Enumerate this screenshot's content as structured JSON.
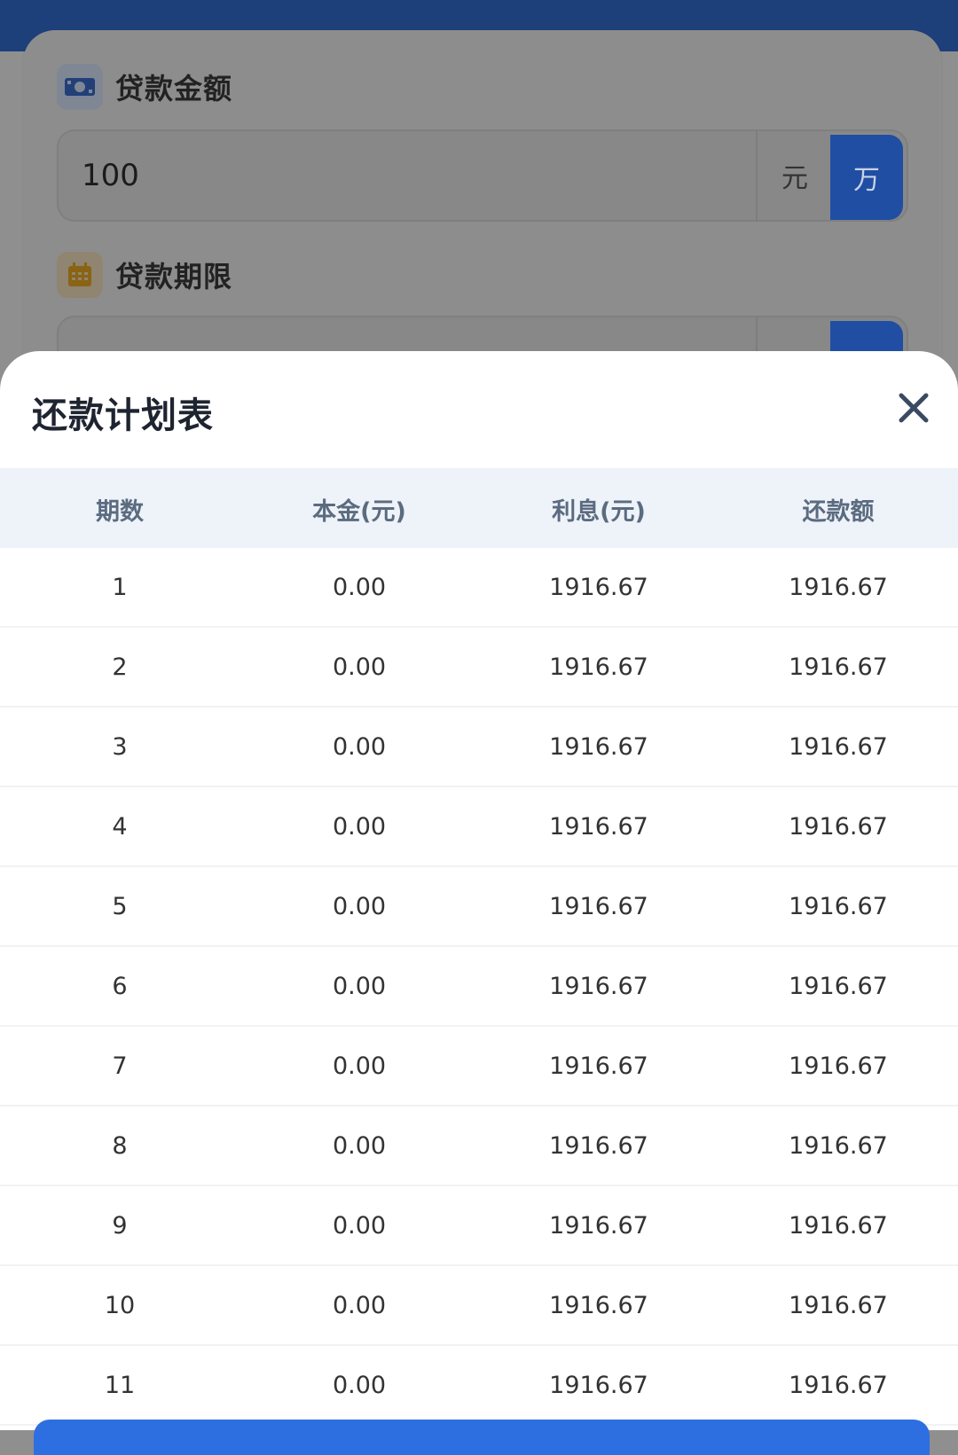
{
  "colors": {
    "primary": "#1f4ea3",
    "header_bg": "#eef3f9",
    "accent_button": "#2d6fe0"
  },
  "form": {
    "loan_amount": {
      "label": "贷款金额",
      "icon": "money-icon",
      "value": "100",
      "unit_yuan": "元",
      "unit_wan": "万",
      "selected_unit": "万"
    },
    "loan_term": {
      "label": "贷款期限",
      "icon": "calendar-icon"
    }
  },
  "sheet": {
    "title": "还款计划表",
    "close_icon": "close-icon",
    "columns": [
      "期数",
      "本金(元)",
      "利息(元)",
      "还款额"
    ],
    "rows": [
      [
        "1",
        "0.00",
        "1916.67",
        "1916.67"
      ],
      [
        "2",
        "0.00",
        "1916.67",
        "1916.67"
      ],
      [
        "3",
        "0.00",
        "1916.67",
        "1916.67"
      ],
      [
        "4",
        "0.00",
        "1916.67",
        "1916.67"
      ],
      [
        "5",
        "0.00",
        "1916.67",
        "1916.67"
      ],
      [
        "6",
        "0.00",
        "1916.67",
        "1916.67"
      ],
      [
        "7",
        "0.00",
        "1916.67",
        "1916.67"
      ],
      [
        "8",
        "0.00",
        "1916.67",
        "1916.67"
      ],
      [
        "9",
        "0.00",
        "1916.67",
        "1916.67"
      ],
      [
        "10",
        "0.00",
        "1916.67",
        "1916.67"
      ],
      [
        "11",
        "0.00",
        "1916.67",
        "1916.67"
      ]
    ]
  }
}
